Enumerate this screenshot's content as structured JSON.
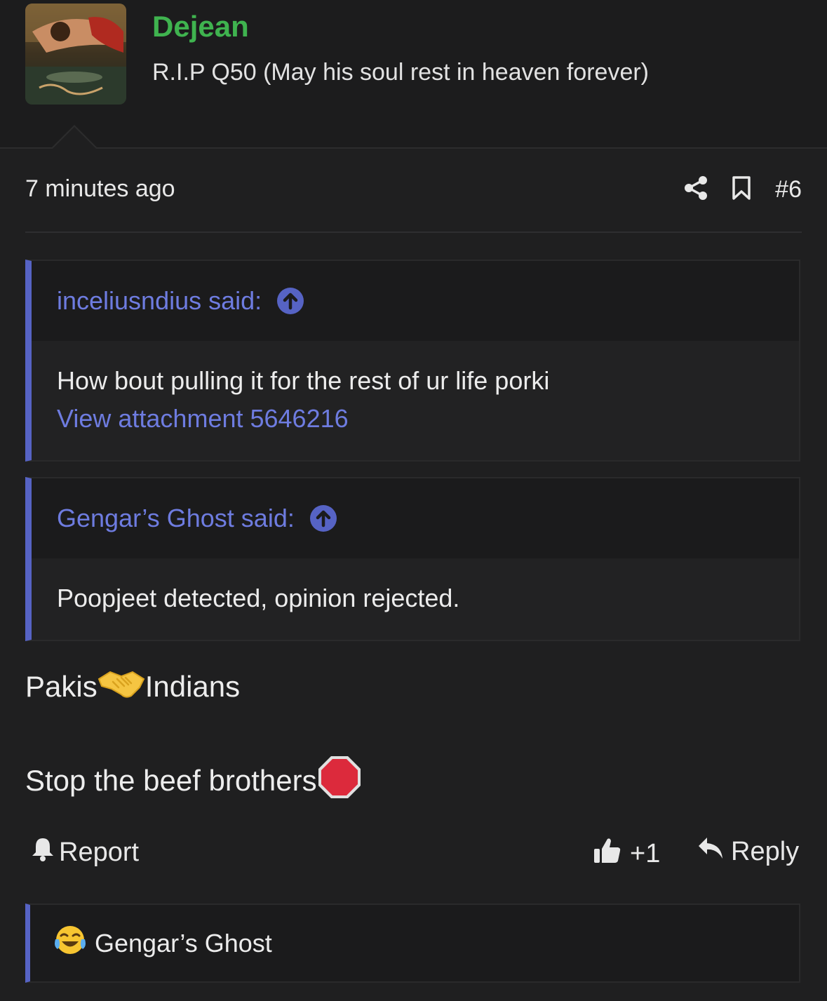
{
  "user": {
    "name": "Dejean",
    "title": "R.I.P Q50 (May his soul rest in heaven forever)"
  },
  "meta": {
    "time": "7 minutes ago",
    "post_number": "#6"
  },
  "quotes": [
    {
      "author": "inceliusndius said:",
      "text": "How bout pulling it for the rest of ur life porki",
      "link": "View attachment 5646216"
    },
    {
      "author": "Gengar’s Ghost said:",
      "text": "Poopjeet detected, opinion rejected.",
      "link": ""
    }
  ],
  "post": {
    "line1_left": "Pakis",
    "line1_right": "Indians",
    "line2": "Stop the beef brothers"
  },
  "actions": {
    "report": "Report",
    "like_count": "+1",
    "reply": "Reply"
  },
  "reactions": {
    "user": "Gengar’s Ghost"
  },
  "colors": {
    "username": "#3fb34f",
    "accent": "#5663c4",
    "link": "#6e7ce0",
    "background": "#1f1f20"
  }
}
